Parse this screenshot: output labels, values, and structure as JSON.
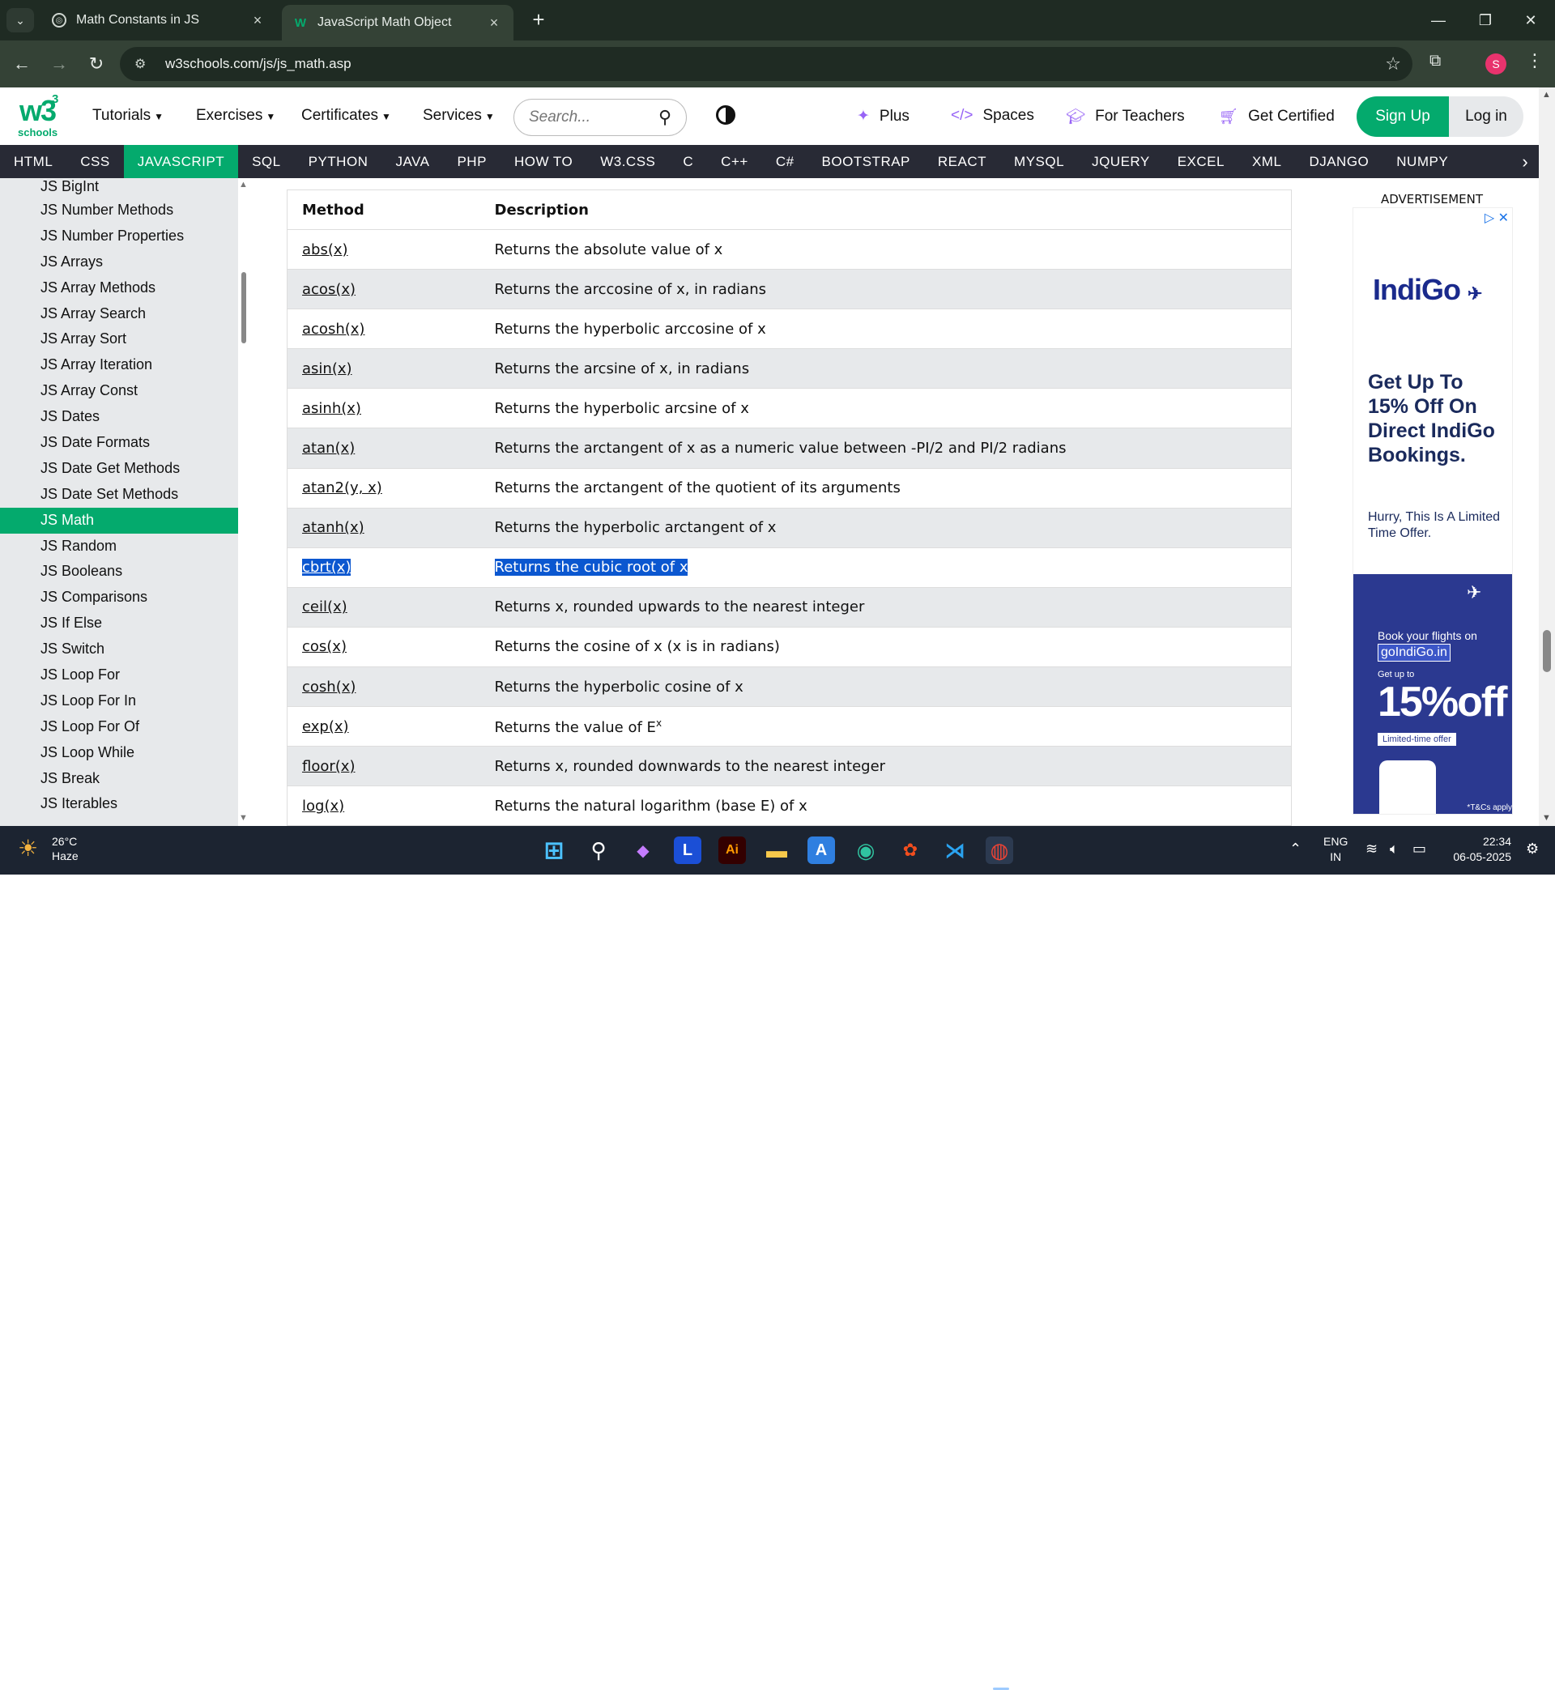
{
  "browser": {
    "tabs": [
      {
        "title": "Math Constants in JS",
        "active": false
      },
      {
        "title": "JavaScript Math Object",
        "active": true
      }
    ],
    "url": "w3schools.com/js/js_math.asp",
    "profile_initial": "S"
  },
  "site": {
    "logo_text": "w3",
    "logo_sup": "3",
    "logo_sub": "schools",
    "menu": [
      "Tutorials",
      "Exercises",
      "Certificates",
      "Services"
    ],
    "search_placeholder": "Search...",
    "links": [
      "Plus",
      "Spaces",
      "For Teachers",
      "Get Certified"
    ],
    "signup": "Sign Up",
    "login": "Log in",
    "subnav": [
      "HTML",
      "CSS",
      "JAVASCRIPT",
      "SQL",
      "PYTHON",
      "JAVA",
      "PHP",
      "HOW TO",
      "W3.CSS",
      "C",
      "C++",
      "C#",
      "BOOTSTRAP",
      "REACT",
      "MYSQL",
      "JQUERY",
      "EXCEL",
      "XML",
      "DJANGO",
      "NUMPY"
    ],
    "subnav_active": "JAVASCRIPT"
  },
  "sidebar": {
    "active": "JS Math",
    "items": [
      "JS BigInt",
      "JS Number Methods",
      "JS Number Properties",
      "JS Arrays",
      "JS Array Methods",
      "JS Array Search",
      "JS Array Sort",
      "JS Array Iteration",
      "JS Array Const",
      "JS Dates",
      "JS Date Formats",
      "JS Date Get Methods",
      "JS Date Set Methods",
      "JS Math",
      "JS Random",
      "JS Booleans",
      "JS Comparisons",
      "JS If Else",
      "JS Switch",
      "JS Loop For",
      "JS Loop For In",
      "JS Loop For Of",
      "JS Loop While",
      "JS Break",
      "JS Iterables"
    ]
  },
  "table": {
    "headers": [
      "Method",
      "Description"
    ],
    "rows": [
      {
        "method": "abs(x)",
        "desc": "Returns the absolute value of x"
      },
      {
        "method": "acos(x)",
        "desc": "Returns the arccosine of x, in radians"
      },
      {
        "method": "acosh(x)",
        "desc": "Returns the hyperbolic arccosine of x"
      },
      {
        "method": "asin(x)",
        "desc": "Returns the arcsine of x, in radians"
      },
      {
        "method": "asinh(x)",
        "desc": "Returns the hyperbolic arcsine of x"
      },
      {
        "method": "atan(x)",
        "desc": "Returns the arctangent of x as a numeric value between -PI/2 and PI/2 radians"
      },
      {
        "method": "atan2(y, x)",
        "desc": "Returns the arctangent of the quotient of its arguments"
      },
      {
        "method": "atanh(x)",
        "desc": "Returns the hyperbolic arctangent of x"
      },
      {
        "method": "cbrt(x)",
        "desc": "Returns the cubic root of x",
        "selected": true
      },
      {
        "method": "ceil(x)",
        "desc": "Returns x, rounded upwards to the nearest integer"
      },
      {
        "method": "cos(x)",
        "desc": "Returns the cosine of x (x is in radians)"
      },
      {
        "method": "cosh(x)",
        "desc": "Returns the hyperbolic cosine of x"
      },
      {
        "method": "exp(x)",
        "desc": "Returns the value of E",
        "sup": "x"
      },
      {
        "method": "floor(x)",
        "desc": "Returns x, rounded downwards to the nearest integer"
      },
      {
        "method": "log(x)",
        "desc": "Returns the natural logarithm (base E) of x"
      }
    ]
  },
  "ad": {
    "label": "ADVERTISEMENT",
    "brand": "IndiGo",
    "headline": "Get Up To 15% Off On Direct IndiGo Bookings.",
    "sub": "Hurry, This Is A Limited Time Offer.",
    "book_text": "Book your flights on",
    "book_site": "goIndiGo.in",
    "get_up_to": "Get up to",
    "offer": "15%off",
    "limited": "Limited-time offer",
    "tc": "*T&Cs apply"
  },
  "taskbar": {
    "temperature": "26°C",
    "weather": "Haze",
    "lang1": "ENG",
    "lang2": "IN",
    "time": "22:34",
    "date": "06-05-2025"
  }
}
